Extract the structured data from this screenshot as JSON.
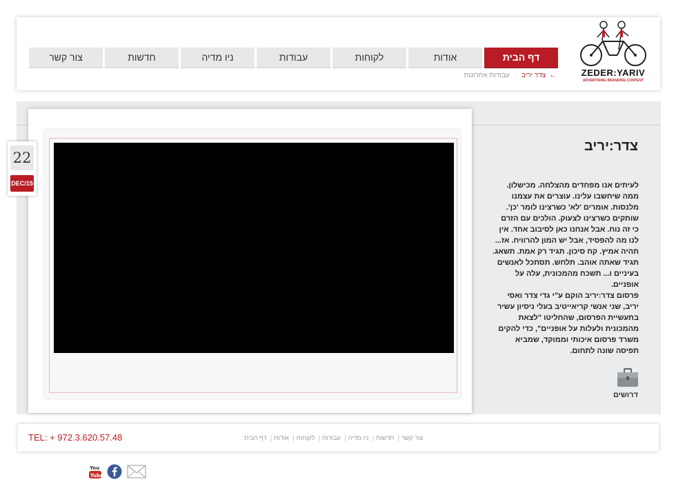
{
  "header": {
    "logo_text": "ZEDER:YARIV",
    "logo_sub": "ADVERTISING BRANDING CONTENT",
    "nav": [
      {
        "label": "דף הבית",
        "active": true
      },
      {
        "label": "אודות"
      },
      {
        "label": "לקוחות"
      },
      {
        "label": "עבודות"
      },
      {
        "label": "ניו מדיה"
      },
      {
        "label": "חדשות"
      },
      {
        "label": "צור קשר"
      }
    ],
    "breadcrumb": {
      "home": "צדר יריב",
      "current": "עבודות אחרונות"
    }
  },
  "date": {
    "day": "22",
    "month": "DEC/15"
  },
  "sidebar": {
    "title": "צדר:יריב",
    "paragraphs": [
      "לעיתים אנו מפחדים מהצלחה. מכישלון. ממה שיחשבו עלינו. עוצרים את עצמנו מלנסות. אומרים 'לא' כשרצינו לומר 'כן'. שותקים כשרצינו לצעוק. הולכים עם הזרם כי זה נוח. אבל אנחנו כאן לסיבוב אחד. אין לנו מה להפסיד, אבל יש המון להרוויח. אז... תהיה אמיץ. קח סיכון. תגיד רק אמת. תשאג. תגיד שאתה אוהב. תלחש. תסתכל לאנשים בעיניים ו... תשכח מהמכונית, עלה על אופניים.",
      "פרסום צדר:יריב הוקם ע\"י גדי צדר ואסי יריב, שני אנשי קריאייטיב בעלי ניסיון עשיר בתעשיית הפרסום, שהחליטו \"לצאת מהמכונית ולעלות על אופניים\", כדי להקים משרד פרסום איכותי וממוקד, שמביא תפיסה שונה לתחום."
    ],
    "jobs_label": "דרושים"
  },
  "footer": {
    "tel": "TEL: + 972.3.620.57.48",
    "links": [
      "צור קשר",
      "חדשות",
      "ניו מדיה",
      "עבודות",
      "לקוחות",
      "אודות",
      "דף הבית"
    ]
  },
  "colors": {
    "brand_red": "#b91c24",
    "nav_gray": "#e8e8e8",
    "panel_bg": "#eaeced"
  },
  "icons": [
    "arrow-left-icon",
    "briefcase-icon",
    "youtube-icon",
    "facebook-icon",
    "mail-icon"
  ]
}
